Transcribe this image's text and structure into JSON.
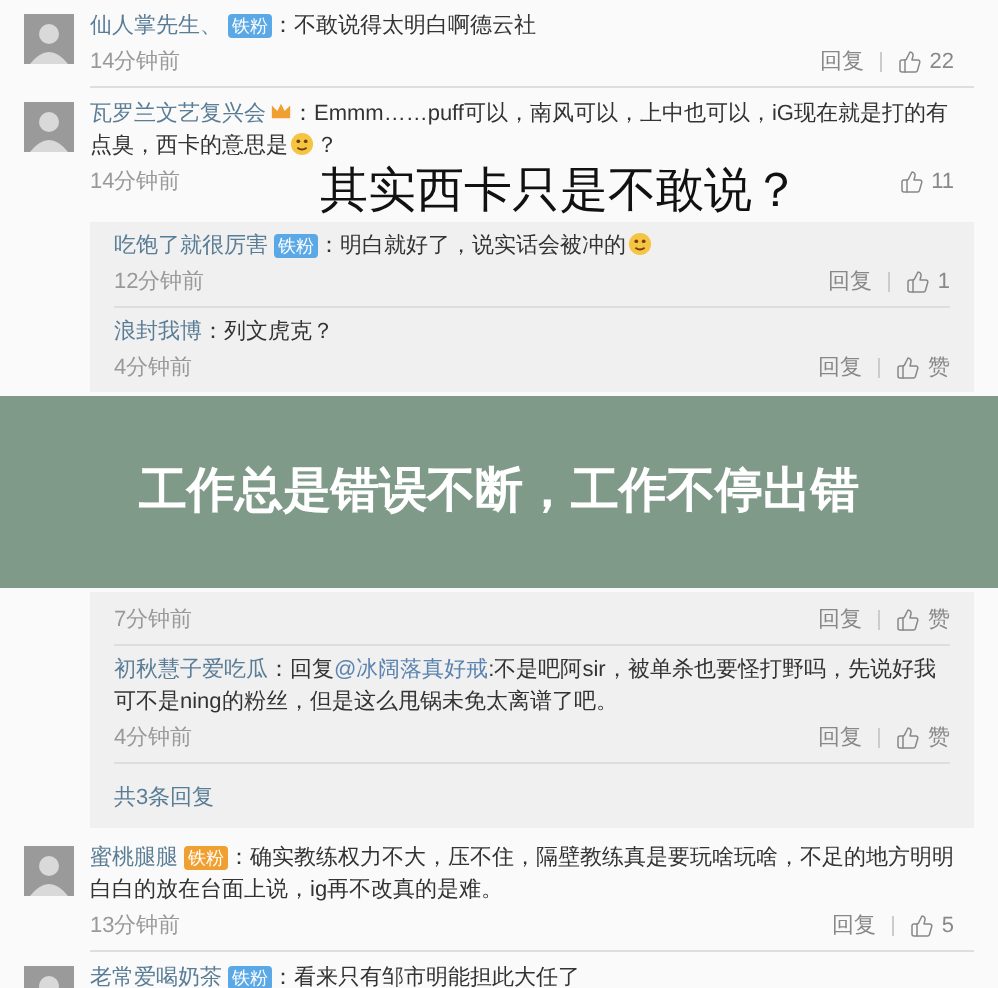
{
  "comments": [
    {
      "user": "仙人掌先生、",
      "badge": {
        "label": "铁粉",
        "color": "#5aa9e6"
      },
      "segments": [
        {
          "kind": "text",
          "text": "：不敢说得太明白啊德云社"
        }
      ],
      "time": "14分钟前",
      "reply_label": "回复",
      "likes": "22"
    },
    {
      "user": "瓦罗兰文艺复兴会",
      "crown": true,
      "segments": [
        {
          "kind": "text",
          "text": "：Emmm……puff可以，南风可以，上中也可以，iG现在就是打的有点臭，西卡的意思是"
        },
        {
          "kind": "emoji"
        },
        {
          "kind": "text",
          "text": "？"
        }
      ],
      "time": "14分钟前",
      "likes": "11",
      "caption": "其实西卡只是不敢说？",
      "replies": [
        {
          "user": "吃饱了就很厉害",
          "badge": {
            "label": "铁粉",
            "color": "#5aa9e6"
          },
          "segments": [
            {
              "kind": "text",
              "text": "：明白就好了，说实话会被冲的"
            },
            {
              "kind": "emoji"
            }
          ],
          "time": "12分钟前",
          "reply_label": "回复",
          "likes": "1"
        },
        {
          "user": "浪封我博",
          "segments": [
            {
              "kind": "text",
              "text": "：列文虎克？"
            }
          ],
          "time": "4分钟前",
          "reply_label": "回复",
          "likes": "赞"
        }
      ]
    },
    {
      "banner": "工作总是错误不断，工作不停出错",
      "replies": [
        {
          "time": "7分钟前",
          "reply_label": "回复",
          "likes": "赞"
        },
        {
          "user": "初秋慧子爱吃瓜",
          "segments": [
            {
              "kind": "text",
              "text": "：回复"
            },
            {
              "kind": "mention",
              "text": "@冰阔落真好戒"
            },
            {
              "kind": "text",
              "text": ":不是吧阿sir，被单杀也要怪打野吗，先说好我可不是ning的粉丝，但是这么甩锅未免太离谱了吧。"
            }
          ],
          "time": "4分钟前",
          "reply_label": "回复",
          "likes": "赞"
        }
      ],
      "reply_count": "共3条回复"
    },
    {
      "user": "蜜桃腿腿",
      "badge": {
        "label": "铁粉",
        "color": "#f0a030"
      },
      "segments": [
        {
          "kind": "text",
          "text": "：确实教练权力不大，压不住，隔壁教练真是要玩啥玩啥，不足的地方明明白白的放在台面上说，ig再不改真的是难。"
        }
      ],
      "time": "13分钟前",
      "reply_label": "回复",
      "likes": "5"
    },
    {
      "user": "老常爱喝奶茶",
      "badge": {
        "label": "铁粉",
        "color": "#5aa9e6"
      },
      "segments": [
        {
          "kind": "text",
          "text": "：看来只有邹市明能担此大任了"
        }
      ]
    }
  ]
}
